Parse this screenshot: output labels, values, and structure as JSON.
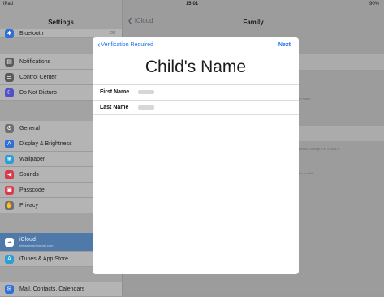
{
  "status_bar": {
    "carrier": "iPad",
    "time": "15:01",
    "battery": "90%"
  },
  "sidebar": {
    "title": "Settings",
    "items": [
      {
        "label": "Bluetooth",
        "icon": "bluetooth-icon",
        "color": "#2f6fd8",
        "trail": "Off"
      },
      {
        "label": "Notifications",
        "icon": "notifications-icon",
        "color": "#5b5b5b"
      },
      {
        "label": "Control Center",
        "icon": "control-center-icon",
        "color": "#5b5b5b"
      },
      {
        "label": "Do Not Disturb",
        "icon": "moon-icon",
        "color": "#5250c8"
      },
      {
        "label": "General",
        "icon": "gear-icon",
        "color": "#6f6f6f"
      },
      {
        "label": "Display & Brightness",
        "icon": "display-icon",
        "color": "#2f6fd8"
      },
      {
        "label": "Wallpaper",
        "icon": "wallpaper-icon",
        "color": "#2a9fd6"
      },
      {
        "label": "Sounds",
        "icon": "sounds-icon",
        "color": "#d83a4a"
      },
      {
        "label": "Passcode",
        "icon": "lock-icon",
        "color": "#d83a4a"
      },
      {
        "label": "Privacy",
        "icon": "hand-icon",
        "color": "#6f6f6f"
      },
      {
        "label": "iCloud",
        "sub": "mikaelangi@gmail.com",
        "icon": "cloud-icon",
        "color": "#ffffff"
      },
      {
        "label": "iTunes & App Store",
        "icon": "app-store-icon",
        "color": "#2a9fd6"
      },
      {
        "label": "Mail, Contacts, Calendars",
        "icon": "mail-icon",
        "color": "#2f6fd8"
      }
    ]
  },
  "detail": {
    "back_label": "iCloud",
    "title": "Family",
    "fragments": [
      "rn more...",
      "ethod. Change it in iTunes &",
      "for a child."
    ]
  },
  "modal": {
    "back_label": "Verification Required",
    "next_label": "Next",
    "heading": "Child's Name",
    "fields": [
      {
        "label": "First Name"
      },
      {
        "label": "Last Name"
      }
    ]
  }
}
